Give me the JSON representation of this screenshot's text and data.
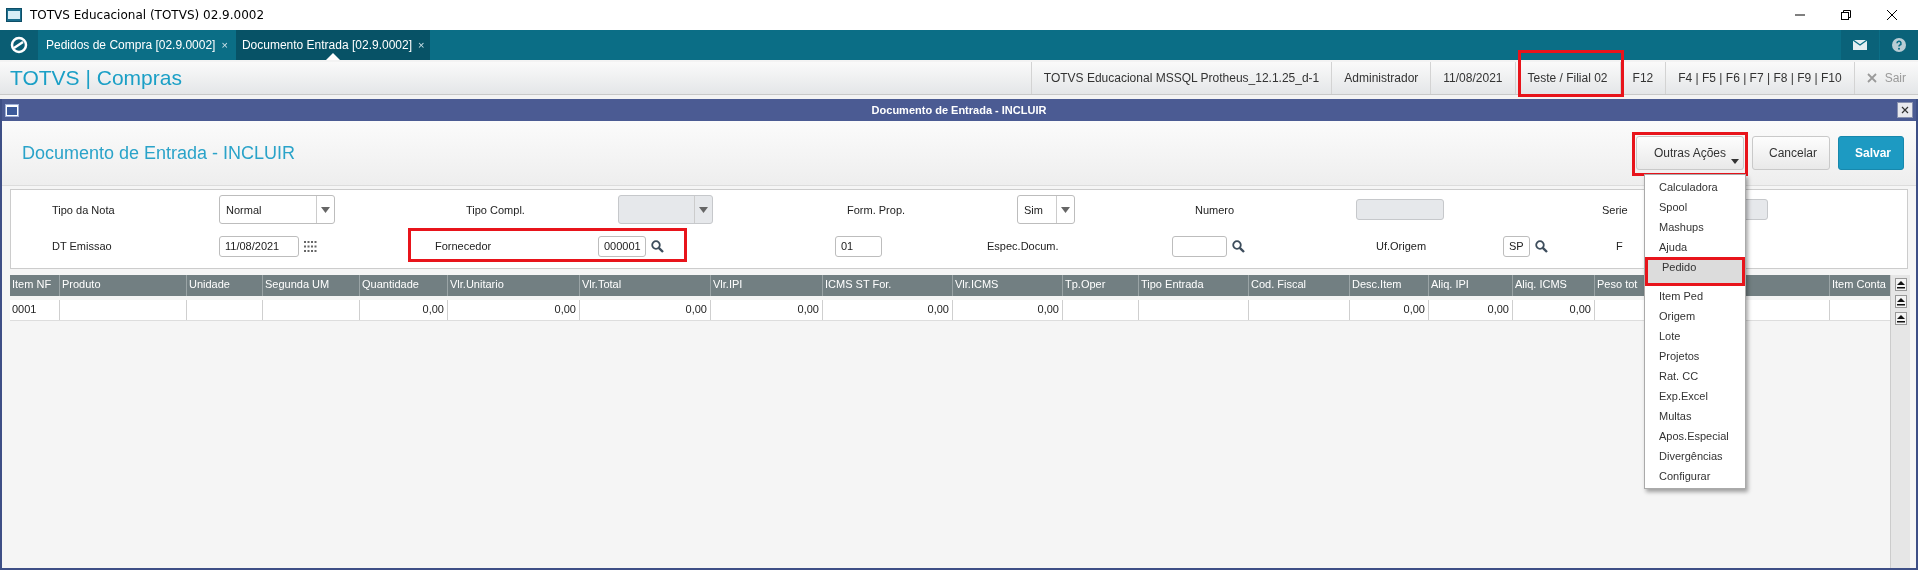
{
  "window": {
    "title": "TOTVS Educacional (TOTVS) 02.9.0002"
  },
  "tabs": [
    {
      "label": "Pedidos de Compra [02.9.0002]",
      "close": "×",
      "selected": false
    },
    {
      "label": "Documento Entrada [02.9.0002]",
      "close": "×",
      "selected": true
    }
  ],
  "module_bar": {
    "title": "TOTVS | Compras",
    "info": [
      {
        "label": "TOTVS Educacional MSSQL Protheus_12.1.25_d-1",
        "highlighted": false
      },
      {
        "label": "Administrador",
        "highlighted": false
      },
      {
        "label": "11/08/2021",
        "highlighted": false
      },
      {
        "label": "Teste / Filial 02",
        "highlighted": true
      },
      {
        "label": "F12",
        "highlighted": false
      },
      {
        "label": "F4 | F5 | F6 | F7 | F8 | F9 | F10",
        "highlighted": false
      }
    ],
    "exit": {
      "label": "Sair",
      "disabled": true
    }
  },
  "dialog": {
    "title": "Documento de Entrada - INCLUIR",
    "heading": "Documento de Entrada - INCLUIR",
    "buttons": [
      {
        "label": "Outras Ações",
        "kind": "dropdown",
        "highlighted": true
      },
      {
        "label": "Cancelar",
        "kind": "secondary",
        "highlighted": false
      },
      {
        "label": "Salvar",
        "kind": "primary",
        "highlighted": false
      }
    ],
    "menu_items": [
      {
        "label": "Calculadora",
        "selected": false,
        "highlighted": false
      },
      {
        "label": "Spool",
        "selected": false,
        "highlighted": false
      },
      {
        "label": "Mashups",
        "selected": false,
        "highlighted": false
      },
      {
        "label": "Ajuda",
        "selected": false,
        "highlighted": false
      },
      {
        "label": "Pedido",
        "selected": true,
        "highlighted": true
      },
      {
        "label": "Item Ped",
        "selected": false,
        "highlighted": false
      },
      {
        "label": "Origem",
        "selected": false,
        "highlighted": false
      },
      {
        "label": "Lote",
        "selected": false,
        "highlighted": false
      },
      {
        "label": "Projetos",
        "selected": false,
        "highlighted": false
      },
      {
        "label": "Rat. CC",
        "selected": false,
        "highlighted": false
      },
      {
        "label": "Exp.Excel",
        "selected": false,
        "highlighted": false
      },
      {
        "label": "Multas",
        "selected": false,
        "highlighted": false
      },
      {
        "label": "Apos.Especial",
        "selected": false,
        "highlighted": false
      },
      {
        "label": "Divergências",
        "selected": false,
        "highlighted": false
      },
      {
        "label": "Configurar",
        "selected": false,
        "highlighted": false
      }
    ]
  },
  "form": {
    "rows": [
      {
        "fields": [
          {
            "label": "Tipo da Nota",
            "kind": "select",
            "value": "Normal",
            "disabled": false,
            "highlighted": false
          },
          {
            "label": "Tipo Compl.",
            "kind": "select",
            "disabled": true,
            "highlighted": false
          },
          {
            "label": "Form. Prop.",
            "kind": "select",
            "value": "Sim",
            "disabled": false,
            "highlighted": false
          },
          {
            "label": "Numero",
            "kind": "text",
            "disabled": true,
            "highlighted": false
          },
          {
            "label": "Serie",
            "kind": "text",
            "disabled": true,
            "highlighted": false
          }
        ]
      },
      {
        "fields": [
          {
            "label": "DT Emissao",
            "kind": "date",
            "value": "11/08/2021",
            "disabled": false,
            "highlighted": false
          },
          {
            "label": "Fornecedor",
            "kind": "lookup",
            "value": "000001",
            "disabled": false,
            "highlighted": true
          },
          {
            "kind": "text",
            "value": "01",
            "disabled": false,
            "highlighted": false
          },
          {
            "label": "Espec.Docum.",
            "kind": "lookup",
            "disabled": false,
            "highlighted": false
          },
          {
            "label": "Uf.Origem",
            "kind": "lookup",
            "value": "SP",
            "disabled": false,
            "highlighted": false
          },
          {
            "label": "F",
            "kind": "label"
          }
        ]
      }
    ]
  },
  "grid": {
    "columns": [
      "Item NF",
      "Produto",
      "Unidade",
      "Segunda UM",
      "Quantidade",
      "Vlr.Unitario",
      "Vlr.Total",
      "Vlr.IPI",
      "ICMS ST For.",
      "Vlr.ICMS",
      "Tp.Oper",
      "Tipo Entrada",
      "Cod. Fiscal",
      "Desc.Item",
      "Aliq. IPI",
      "Aliq. ICMS",
      "Peso tot",
      "Item Conta"
    ],
    "rows": [
      [
        "0001",
        null,
        null,
        null,
        "0,00",
        "0,00",
        "0,00",
        "0,00",
        "0,00",
        "0,00",
        null,
        null,
        null,
        "0,00",
        "0,00",
        "0,00",
        null,
        null
      ]
    ]
  }
}
